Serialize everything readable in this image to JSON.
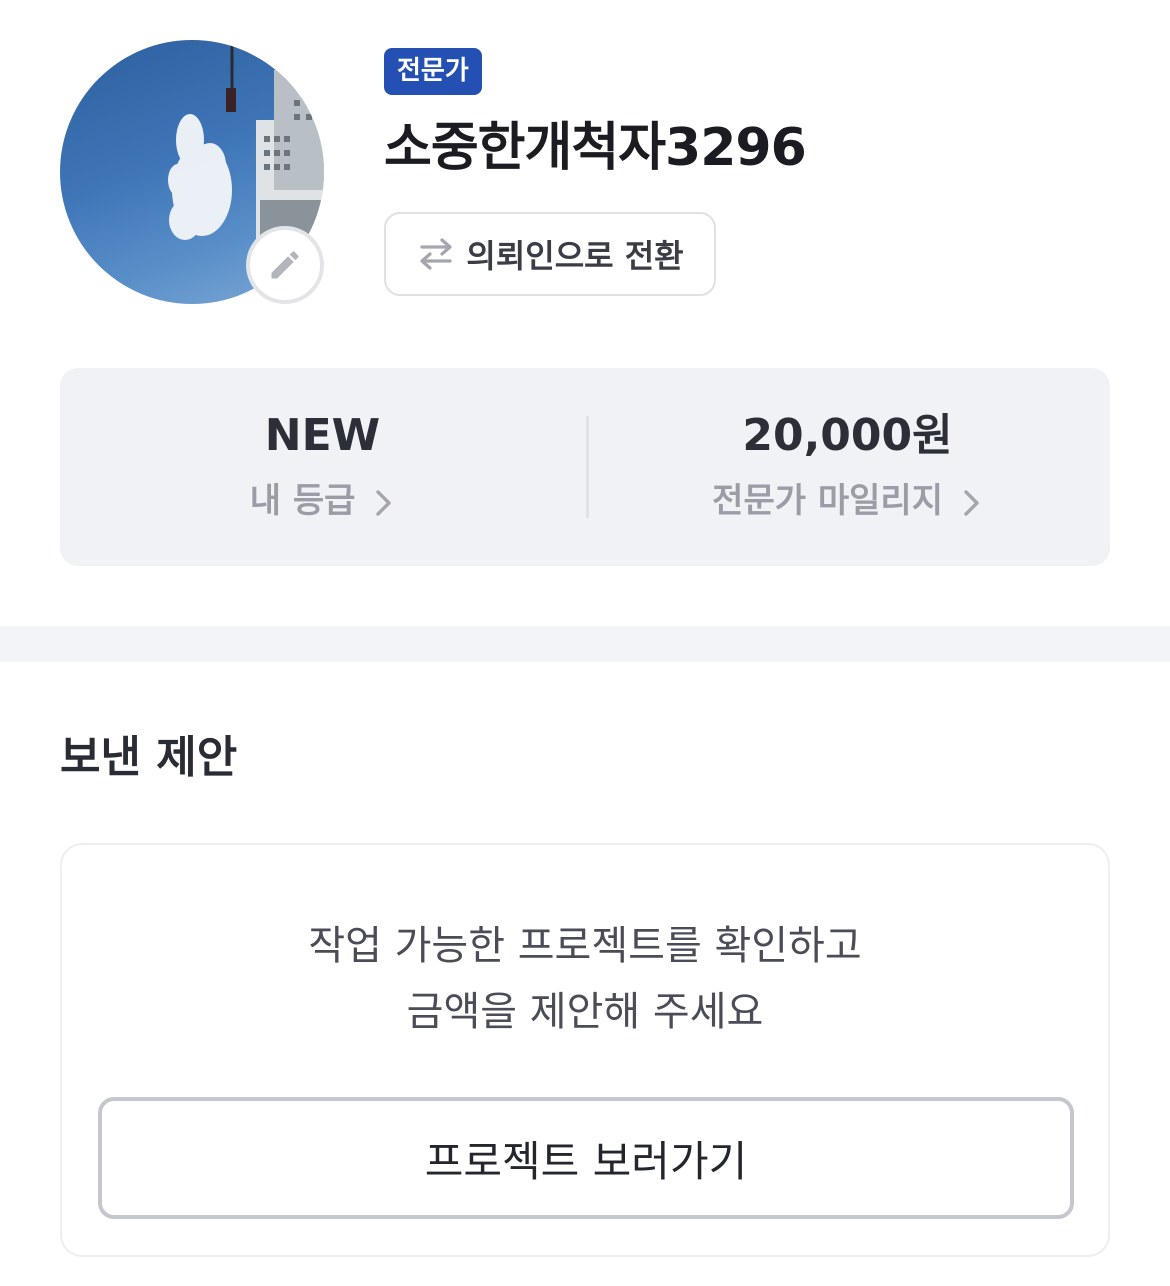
{
  "profile": {
    "badge": "전문가",
    "username": "소중한개척자3296",
    "switch_label": "의뢰인으로 전환",
    "icons": {
      "avatar": "profile-photo",
      "edit": "pencil-icon",
      "switch": "swap-arrows-icon"
    }
  },
  "stats": {
    "grade": {
      "value": "NEW",
      "label": "내 등급"
    },
    "mileage": {
      "value": "20,000원",
      "label": "전문가 마일리지"
    }
  },
  "sent_proposals": {
    "title": "보낸 제안",
    "message_line1": "작업 가능한 프로젝트를 확인하고",
    "message_line2": "금액을 제안해 주세요",
    "button_label": "프로젝트 보러가기"
  },
  "colors": {
    "badge_bg": "#2450b4",
    "card_bg": "#f1f2f6",
    "muted_text": "#9a9ca6"
  }
}
